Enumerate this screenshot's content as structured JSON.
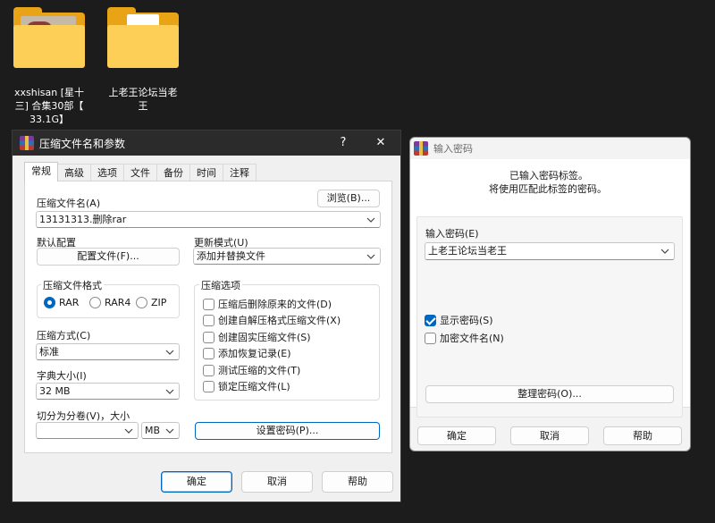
{
  "desktop": {
    "icons": [
      {
        "label": "xxshisan [星十\n三] 合集30部【\n33.1G】"
      },
      {
        "label": "上老王论坛当老\n王"
      }
    ]
  },
  "archive_dialog": {
    "title": "压缩文件名和参数",
    "help_btn": "?",
    "close_btn": "✕",
    "tabs": [
      "常规",
      "高级",
      "选项",
      "文件",
      "备份",
      "时间",
      "注释"
    ],
    "archive_name_label": "压缩文件名(A)",
    "browse_button": "浏览(B)...",
    "archive_name_value": "13131313.删除rar",
    "default_profile_label": "默认配置",
    "profile_button": "配置文件(F)...",
    "update_mode_label": "更新模式(U)",
    "update_mode_value": "添加并替换文件",
    "format_group_title": "压缩文件格式",
    "formats": [
      "RAR",
      "RAR4",
      "ZIP"
    ],
    "method_label": "压缩方式(C)",
    "method_value": "标准",
    "dict_label": "字典大小(I)",
    "dict_value": "32 MB",
    "split_label": "切分为分卷(V)，大小",
    "split_value": "",
    "split_unit": "MB",
    "options_group_title": "压缩选项",
    "options": [
      {
        "label": "压缩后删除原来的文件(D)",
        "checked": false
      },
      {
        "label": "创建自解压格式压缩文件(X)",
        "checked": false
      },
      {
        "label": "创建固实压缩文件(S)",
        "checked": false
      },
      {
        "label": "添加恢复记录(E)",
        "checked": false
      },
      {
        "label": "测试压缩的文件(T)",
        "checked": false
      },
      {
        "label": "锁定压缩文件(L)",
        "checked": false
      }
    ],
    "set_password_button": "设置密码(P)...",
    "ok_button": "确定",
    "cancel_button": "取消",
    "help_button": "帮助"
  },
  "password_dialog": {
    "title": "输入密码",
    "message_line1": "已输入密码标签。",
    "message_line2": "将使用匹配此标签的密码。",
    "password_label": "输入密码(E)",
    "password_value": "上老王论坛当老王",
    "show_password_label": "显示密码(S)",
    "show_password_checked": true,
    "encrypt_names_label": "加密文件名(N)",
    "encrypt_names_checked": false,
    "organize_button": "整理密码(O)...",
    "ok_button": "确定",
    "cancel_button": "取消",
    "help_button": "帮助"
  },
  "colors": {
    "accent": "#0067c0",
    "folder": "#fdcf56",
    "desktop": "#1c1c1c"
  }
}
